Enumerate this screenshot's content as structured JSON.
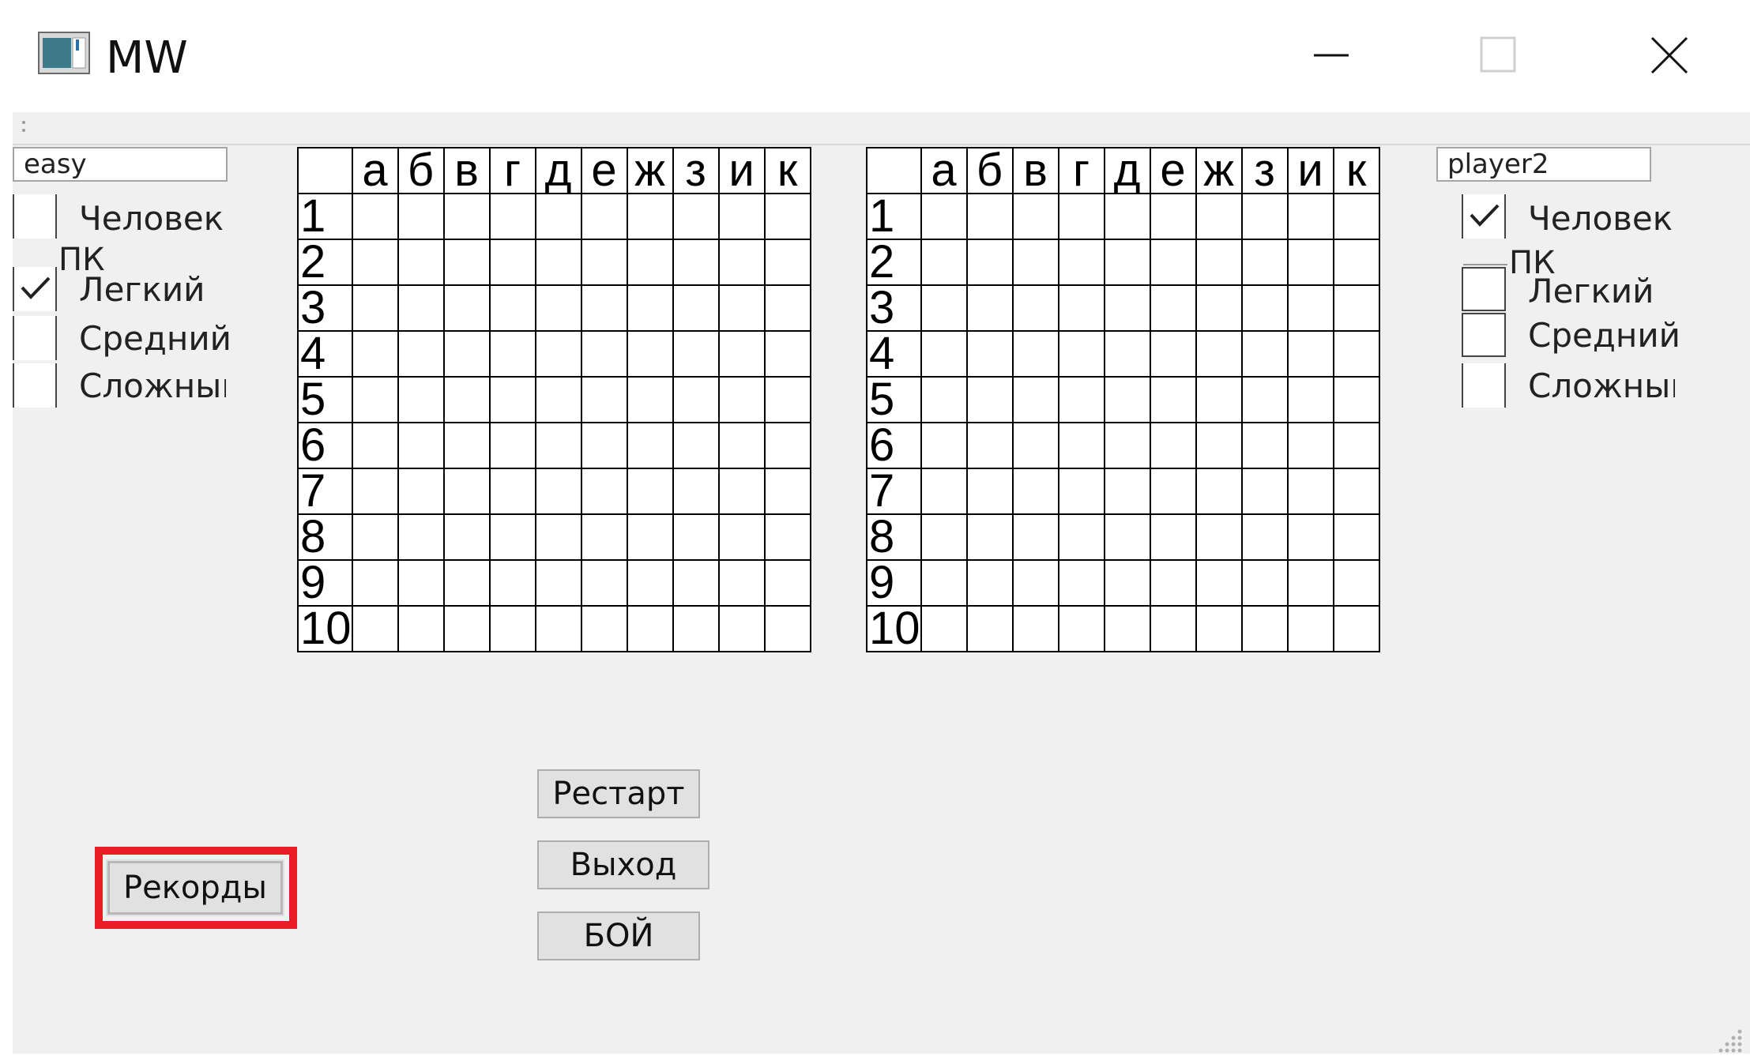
{
  "window": {
    "title": "MW",
    "controls": {
      "minimize": "minimize-icon",
      "maximize": "maximize-icon",
      "close": "close-icon"
    }
  },
  "player1": {
    "name": "easy",
    "options": {
      "human": "Человек",
      "pc_group": "ПК",
      "easy": "Легкий",
      "medium": "Средний",
      "hard": "Сложный"
    },
    "checked": {
      "human": false,
      "easy": true,
      "medium": false,
      "hard": false
    }
  },
  "player2": {
    "name": "player2",
    "options": {
      "human": "Человек",
      "pc_group": "ПК",
      "easy": "Легкий",
      "medium": "Средний",
      "hard": "Сложный"
    },
    "checked": {
      "human": true,
      "easy": false,
      "medium": false,
      "hard": false
    }
  },
  "board": {
    "columns": [
      "а",
      "б",
      "в",
      "г",
      "д",
      "е",
      "ж",
      "з",
      "и",
      "к"
    ],
    "rows": [
      "1",
      "2",
      "3",
      "4",
      "5",
      "6",
      "7",
      "8",
      "9",
      "10"
    ]
  },
  "buttons": {
    "restart": "Рестарт",
    "exit": "Выход",
    "battle": "БОЙ",
    "records": "Рекорды"
  },
  "colors": {
    "highlight": "#e81c24",
    "window_bg": "#f0f0f0",
    "button_bg": "#e1e1e1"
  }
}
